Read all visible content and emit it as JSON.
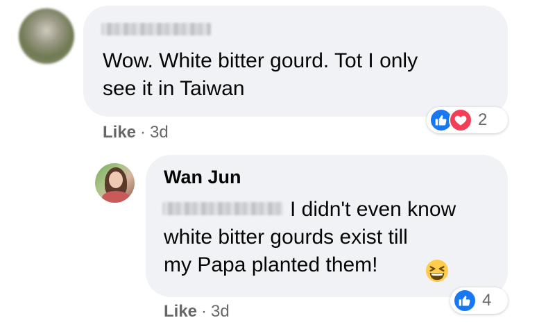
{
  "comments": [
    {
      "author_name": "",
      "text": "Wow. White bitter gourd. Tot I only\nsee it in Taiwan",
      "like_label": "Like",
      "separator": "·",
      "time": "3d",
      "reactions": {
        "types": [
          "like-icon",
          "love-icon"
        ],
        "count": "2"
      }
    },
    {
      "author_name": "Wan Jun",
      "text_first_line": "I didn't even know",
      "text_rest": "white bitter gourds exist till\nmy Papa planted them!",
      "emoji": "grinning-squinting-face-emoji",
      "like_label": "Like",
      "separator": "·",
      "time": "3d",
      "reactions": {
        "types": [
          "like-icon"
        ],
        "count": "4"
      }
    }
  ],
  "colors": {
    "bubble": "#f0f2f5",
    "meta_text": "#65676b",
    "like_blue": "#1877f2",
    "love_red": "#f33e58"
  }
}
